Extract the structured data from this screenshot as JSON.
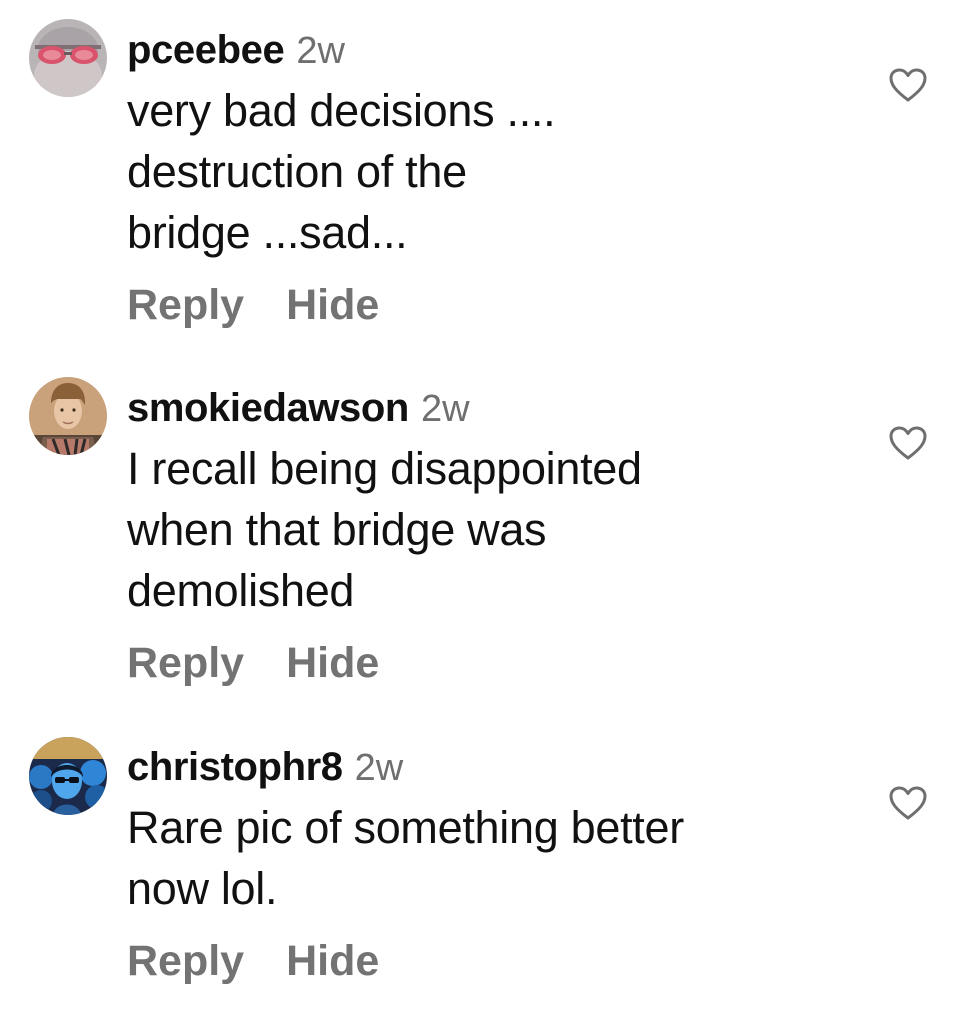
{
  "comments": [
    {
      "username": "pceebee",
      "time": "2w",
      "text": "very bad decisions ....\ndestruction of the\nbridge ...sad...",
      "reply_label": "Reply",
      "hide_label": "Hide",
      "avatar_icon": "avatar-photo-icon",
      "like_icon": "heart-outline-icon"
    },
    {
      "username": "smokiedawson",
      "time": "2w",
      "text": "I recall being disappointed\nwhen that bridge was\ndemolished",
      "reply_label": "Reply",
      "hide_label": "Hide",
      "avatar_icon": "avatar-photo-icon",
      "like_icon": "heart-outline-icon"
    },
    {
      "username": "christophr8",
      "time": "2w",
      "text": "Rare pic of something better\nnow lol.",
      "reply_label": "Reply",
      "hide_label": "Hide",
      "avatar_icon": "avatar-photo-icon",
      "like_icon": "heart-outline-icon"
    }
  ],
  "colors": {
    "text": "#111111",
    "secondary": "#737373",
    "background": "#ffffff"
  }
}
